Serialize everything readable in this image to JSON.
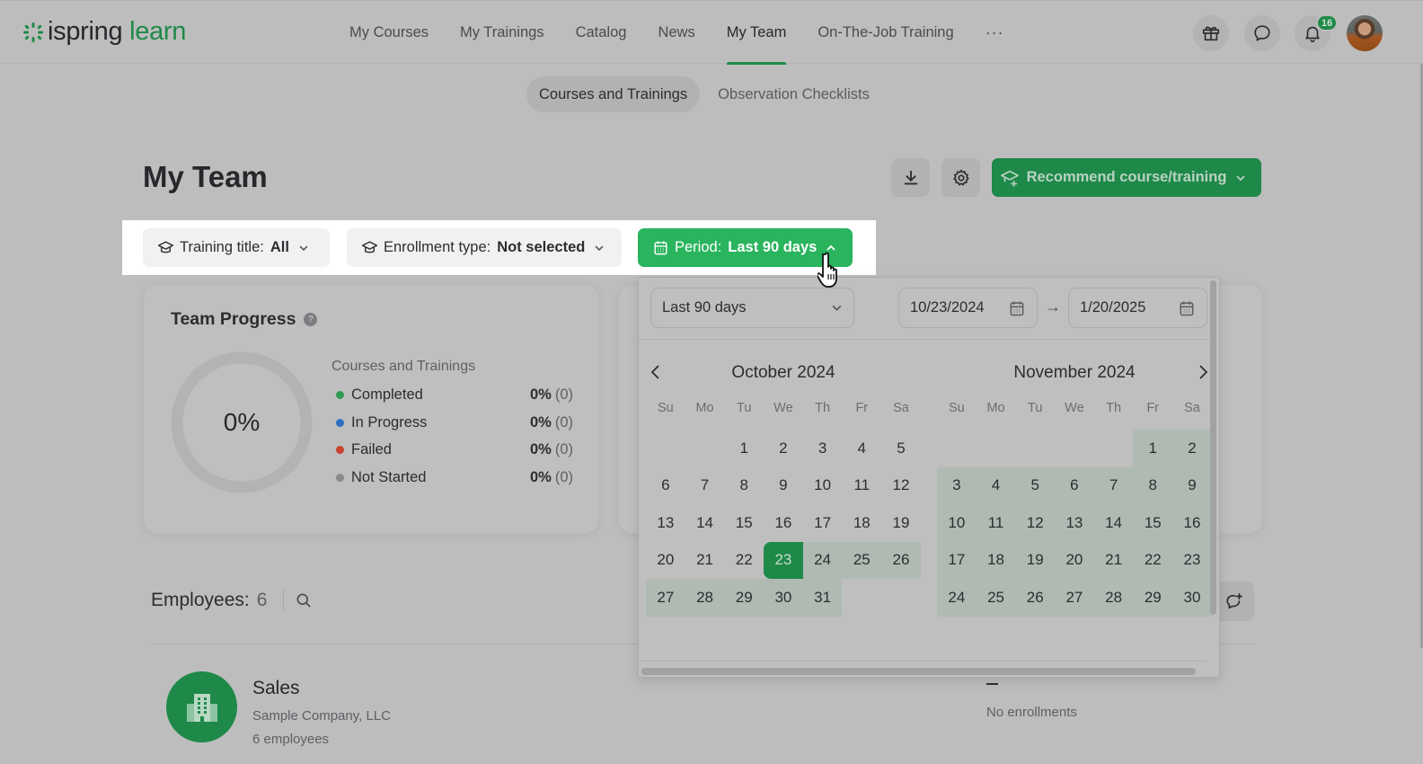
{
  "app": {
    "brand_part1": "ispring",
    "brand_part2": "learn",
    "brand_color": "#1f8a47"
  },
  "nav": {
    "items": [
      {
        "label": "My Courses",
        "active": false
      },
      {
        "label": "My Trainings",
        "active": false
      },
      {
        "label": "Catalog",
        "active": false
      },
      {
        "label": "News",
        "active": false
      },
      {
        "label": "My Team",
        "active": true
      },
      {
        "label": "On-The-Job Training",
        "active": false
      }
    ],
    "more_label": "···"
  },
  "header_icons": {
    "gift": "gift-icon",
    "chat": "chat-icon",
    "notifications": "bell-icon",
    "notification_count": "16"
  },
  "subtabs": [
    {
      "label": "Courses and Trainings",
      "active": true
    },
    {
      "label": "Observation Checklists",
      "active": false
    }
  ],
  "page": {
    "title": "My Team",
    "recommend_label": "Recommend course/training"
  },
  "filters": {
    "training_title_label": "Training title:",
    "training_title_value": "All",
    "enrollment_type_label": "Enrollment type:",
    "enrollment_type_value": "Not selected",
    "period_label": "Period:",
    "period_value": "Last 90 days"
  },
  "team_progress": {
    "title": "Team Progress",
    "help": "?",
    "overall_percent": "0%",
    "legend_title": "Courses and Trainings",
    "legend": [
      {
        "label": "Completed",
        "percent": "0%",
        "count": "(0)",
        "color": "#2f9a55"
      },
      {
        "label": "In Progress",
        "percent": "0%",
        "count": "(0)",
        "color": "#2f6fc0"
      },
      {
        "label": "Failed",
        "percent": "0%",
        "count": "(0)",
        "color": "#c9442f"
      },
      {
        "label": "Not Started",
        "percent": "0%",
        "count": "(0)",
        "color": "#8a8a8a"
      }
    ]
  },
  "employees": {
    "label": "Employees:",
    "count": "6"
  },
  "org": {
    "name": "Sales",
    "company": "Sample Company, LLC",
    "employees": "6 employees",
    "enrollments": "No enrollments"
  },
  "period_popup": {
    "preset": "Last 90 days",
    "start_date": "10/23/2024",
    "end_date": "1/20/2025",
    "arrow": "→",
    "weekdays": [
      "Su",
      "Mo",
      "Tu",
      "We",
      "Th",
      "Fr",
      "Sa"
    ],
    "months": [
      {
        "title": "October 2024",
        "weeks": [
          [
            "",
            "",
            "1",
            "2",
            "3",
            "4",
            "5"
          ],
          [
            "6",
            "7",
            "8",
            "9",
            "10",
            "11",
            "12"
          ],
          [
            "13",
            "14",
            "15",
            "16",
            "17",
            "18",
            "19"
          ],
          [
            "20",
            "21",
            "22",
            "23",
            "24",
            "25",
            "26"
          ],
          [
            "27",
            "28",
            "29",
            "30",
            "31",
            "",
            ""
          ]
        ],
        "selected_day": "23",
        "range_from_day": 23,
        "range_to_day": 31
      },
      {
        "title": "November 2024",
        "weeks": [
          [
            "",
            "",
            "",
            "",
            "",
            "1",
            "2"
          ],
          [
            "3",
            "4",
            "5",
            "6",
            "7",
            "8",
            "9"
          ],
          [
            "10",
            "11",
            "12",
            "13",
            "14",
            "15",
            "16"
          ],
          [
            "17",
            "18",
            "19",
            "20",
            "21",
            "22",
            "23"
          ],
          [
            "24",
            "25",
            "26",
            "27",
            "28",
            "29",
            "30"
          ]
        ],
        "selected_day": "",
        "range_from_day": 1,
        "range_to_day": 30
      }
    ]
  }
}
